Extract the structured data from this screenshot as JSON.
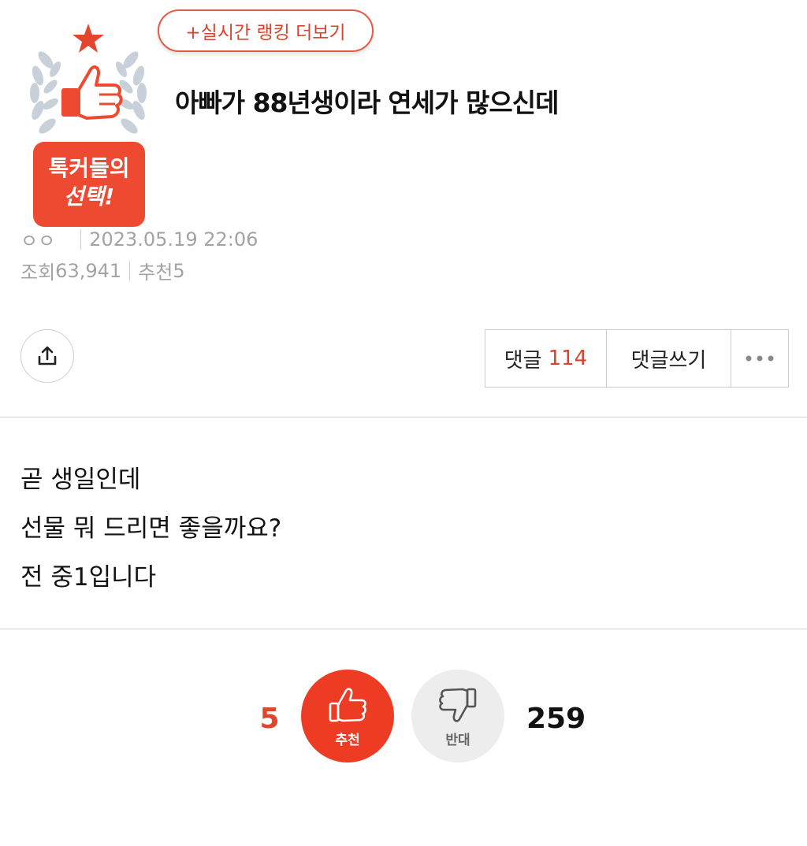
{
  "ranking_button": "+실시간 랭킹 더보기",
  "badge": {
    "line1": "톡커들의",
    "line2": "선택!"
  },
  "post": {
    "title": "아빠가 88년생이라 연세가 많으신데",
    "author": "ㅇㅇ",
    "datetime": "2023.05.19 22:06",
    "views_label": "조회",
    "views": "63,941",
    "recommend_label": "추천",
    "recommend": "5"
  },
  "actions": {
    "comments_label": "댓글",
    "comments_count": "114",
    "write_comment": "댓글쓰기"
  },
  "body": {
    "lines": [
      "곧 생일인데",
      "선물 뭐 드리면 좋을까요?",
      "전 중1입니다"
    ]
  },
  "vote": {
    "up_count": "5",
    "up_label": "추천",
    "down_label": "반대",
    "down_count": "259"
  },
  "colors": {
    "accent": "#ee3b24",
    "muted": "#a3a3a3"
  },
  "icons": [
    "star-icon",
    "laurel-icon",
    "thumbs-up-icon",
    "share-icon",
    "more-icon",
    "thumbs-down-icon"
  ]
}
